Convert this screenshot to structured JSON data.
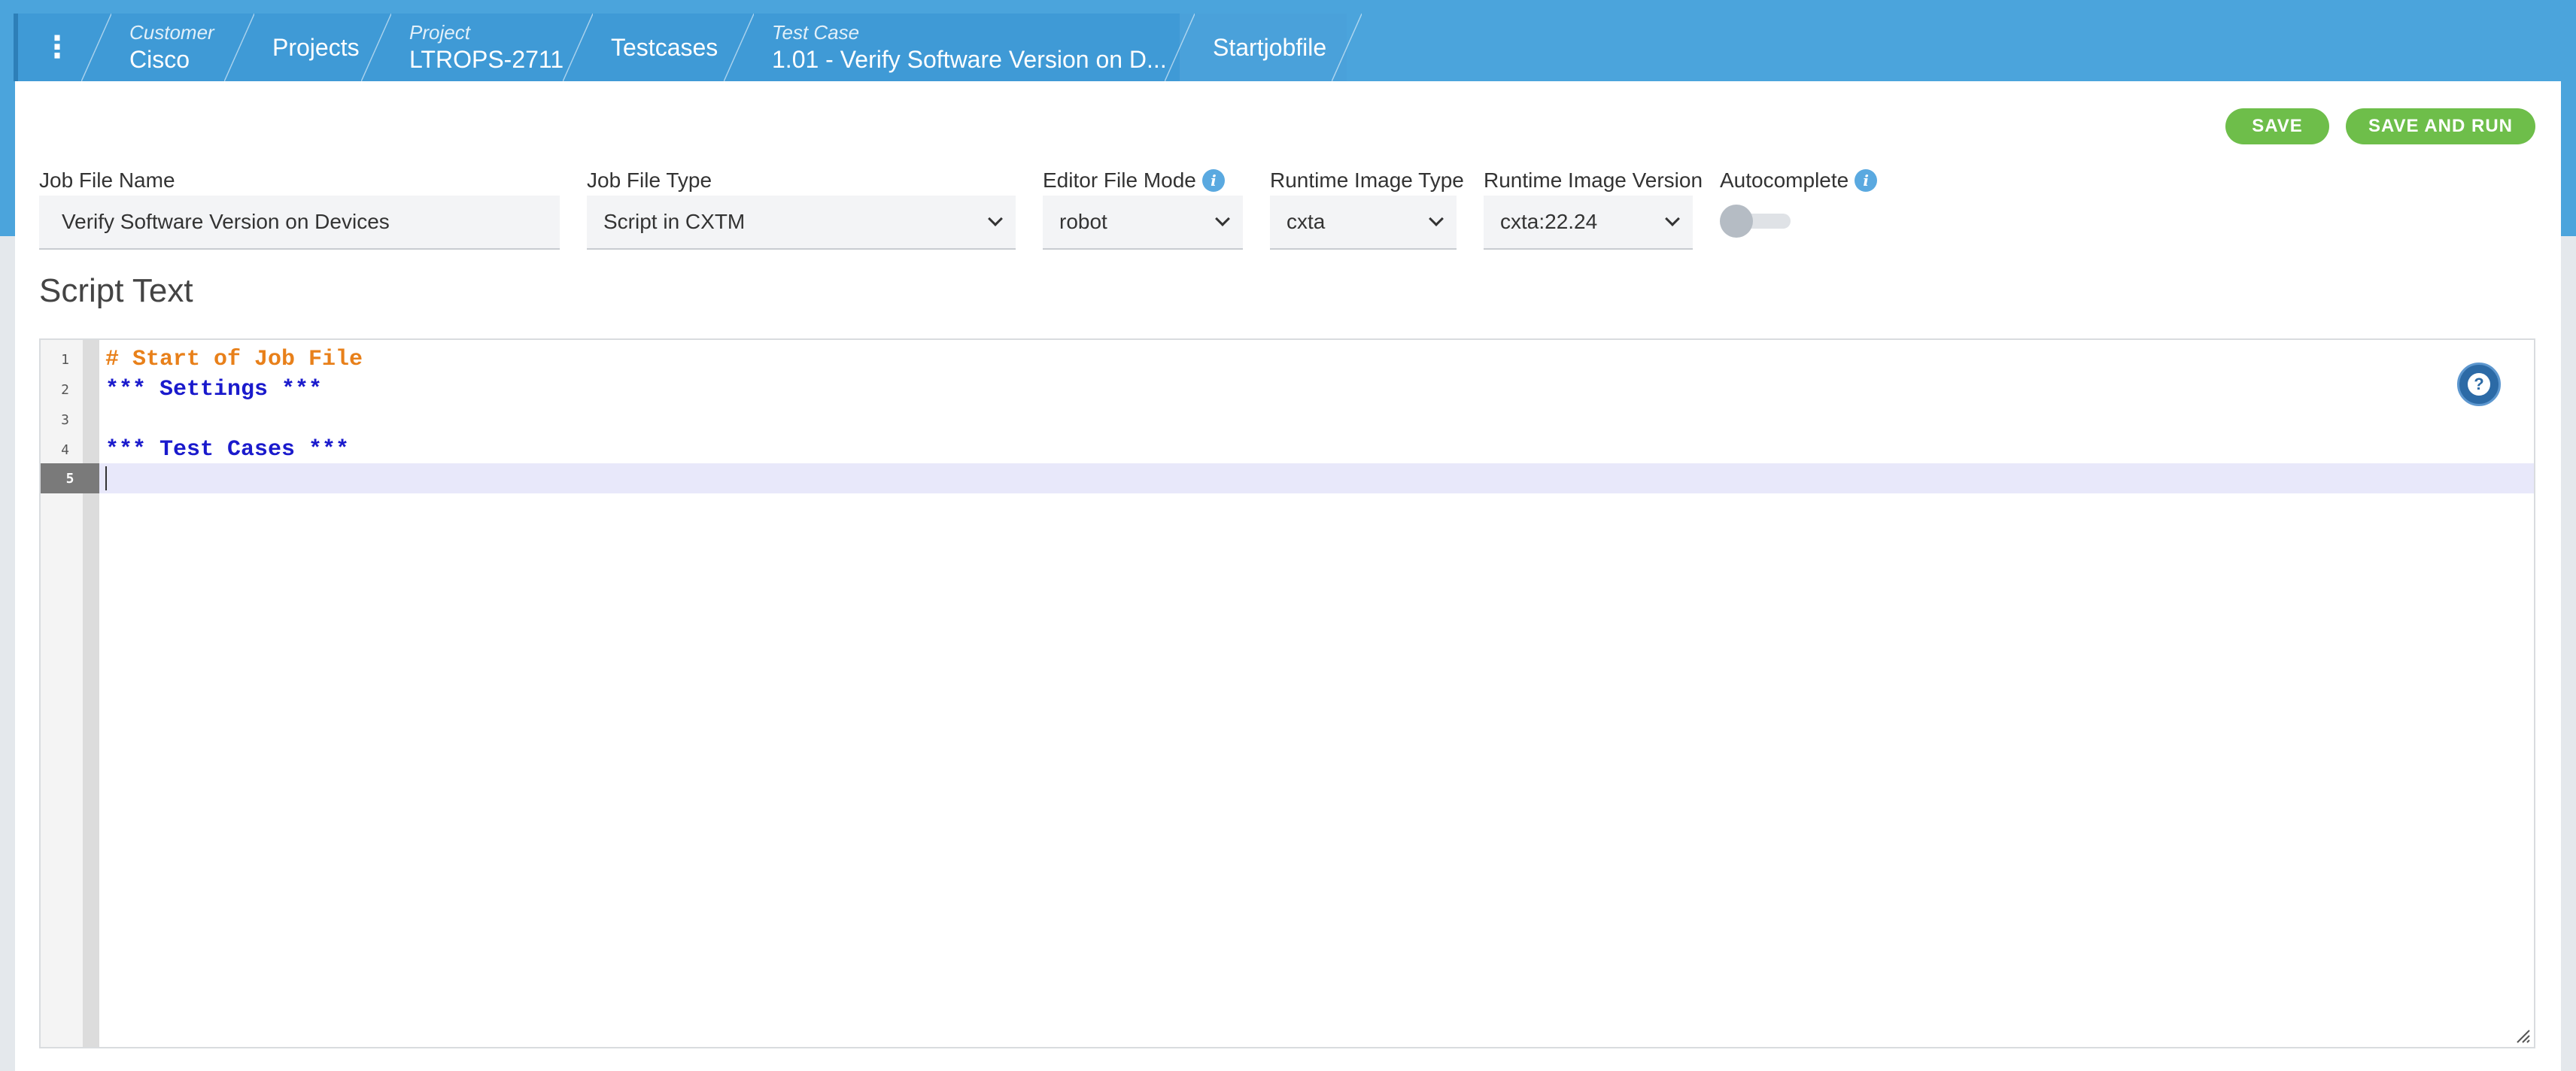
{
  "breadcrumb": {
    "menu_icon": "vertical-dots-icon",
    "items": [
      {
        "sub": "Customer",
        "main": "Cisco"
      },
      {
        "sub": "",
        "main": "Projects"
      },
      {
        "sub": "Project",
        "main": "LTROPS-2711"
      },
      {
        "sub": "",
        "main": "Testcases"
      },
      {
        "sub": "Test Case",
        "main": "1.01 - Verify Software Version on D..."
      },
      {
        "sub": "",
        "main": "Startjobfile"
      }
    ]
  },
  "toolbar": {
    "save_label": "SAVE",
    "save_and_run_label": "SAVE AND RUN"
  },
  "form": {
    "job_file_name": {
      "label": "Job File Name",
      "value": "Verify Software Version on Devices"
    },
    "job_file_type": {
      "label": "Job File Type",
      "value": "Script in CXTM"
    },
    "editor_file_mode": {
      "label": "Editor File Mode",
      "value": "robot"
    },
    "runtime_image_type": {
      "label": "Runtime Image Type",
      "value": "cxta"
    },
    "runtime_image_version": {
      "label": "Runtime Image Version",
      "value": "cxta:22.24"
    },
    "autocomplete": {
      "label": "Autocomplete",
      "enabled": false
    }
  },
  "script": {
    "title": "Script Text",
    "lines": [
      {
        "num": "1",
        "text": "# Start of Job File",
        "kind": "comment"
      },
      {
        "num": "2",
        "text": "*** Settings ***",
        "kind": "keyword"
      },
      {
        "num": "3",
        "text": "",
        "kind": "plain"
      },
      {
        "num": "4",
        "text": "*** Test Cases ***",
        "kind": "keyword"
      },
      {
        "num": "5",
        "text": "",
        "kind": "plain"
      }
    ],
    "active_line": "5",
    "help_icon": "question-icon"
  },
  "colors": {
    "header_blue": "#4ba4dc",
    "button_green": "#6ebe4a",
    "comment": "#e8801a",
    "keyword": "#1a1acc"
  }
}
